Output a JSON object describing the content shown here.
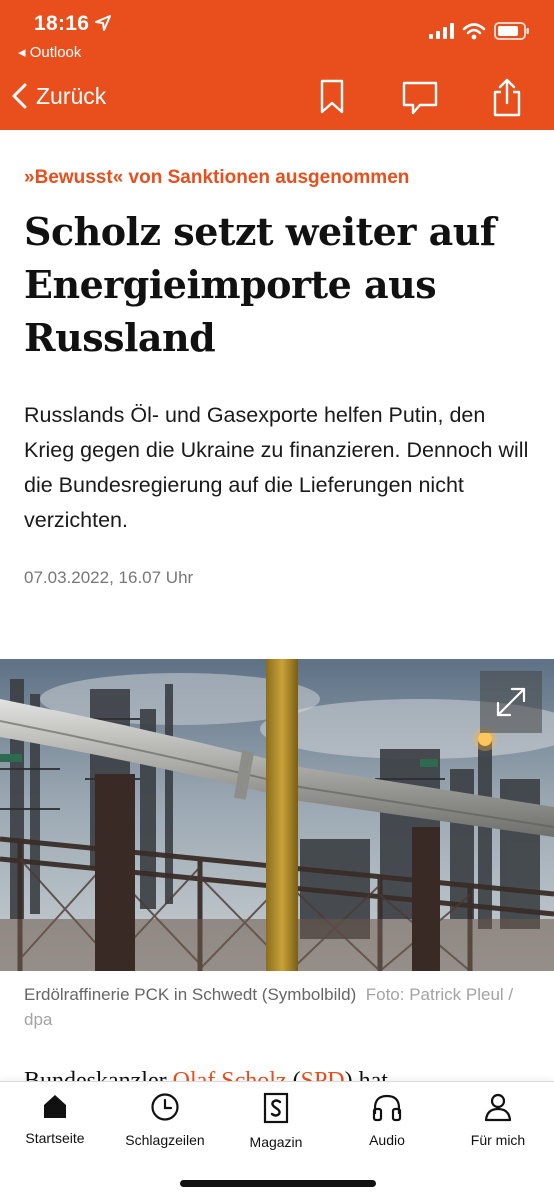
{
  "status_bar": {
    "time": "18:16",
    "back_app": "◂ Outlook"
  },
  "nav": {
    "back_label": "Zurück",
    "actions": [
      "bookmark-icon",
      "comment-icon",
      "share-icon"
    ]
  },
  "article": {
    "kicker": "»Bewusst« von Sanktionen ausgenommen",
    "headline": "Scholz setzt weiter auf Energieimporte aus Russland",
    "lead": "Russlands Öl- und Gasexporte helfen Putin, den Krieg gegen die Ukraine zu finanzieren. Dennoch will die Bundesregierung auf die Lieferungen nicht verzichten.",
    "date": "07.03.2022, 16.07 Uhr",
    "image_caption": "Erdölraffinerie PCK in Schwedt (Symbolbild)",
    "image_credit": "Foto: Patrick Pleul / dpa",
    "body_start": "Bundeskanzler",
    "body_link_1": "Olaf Scholz",
    "body_mid": " (",
    "body_link_2": "SPD",
    "body_end": ") hat"
  },
  "tabbar": {
    "items": [
      {
        "label": "Startseite",
        "icon": "home-icon"
      },
      {
        "label": "Schlagzeilen",
        "icon": "clock-icon"
      },
      {
        "label": "Magazin",
        "icon": "magazine-icon"
      },
      {
        "label": "Audio",
        "icon": "headphones-icon"
      },
      {
        "label": "Für mich",
        "icon": "person-icon"
      }
    ]
  },
  "colors": {
    "brand": "#e84f1c",
    "text": "#111111",
    "muted": "#777777"
  }
}
